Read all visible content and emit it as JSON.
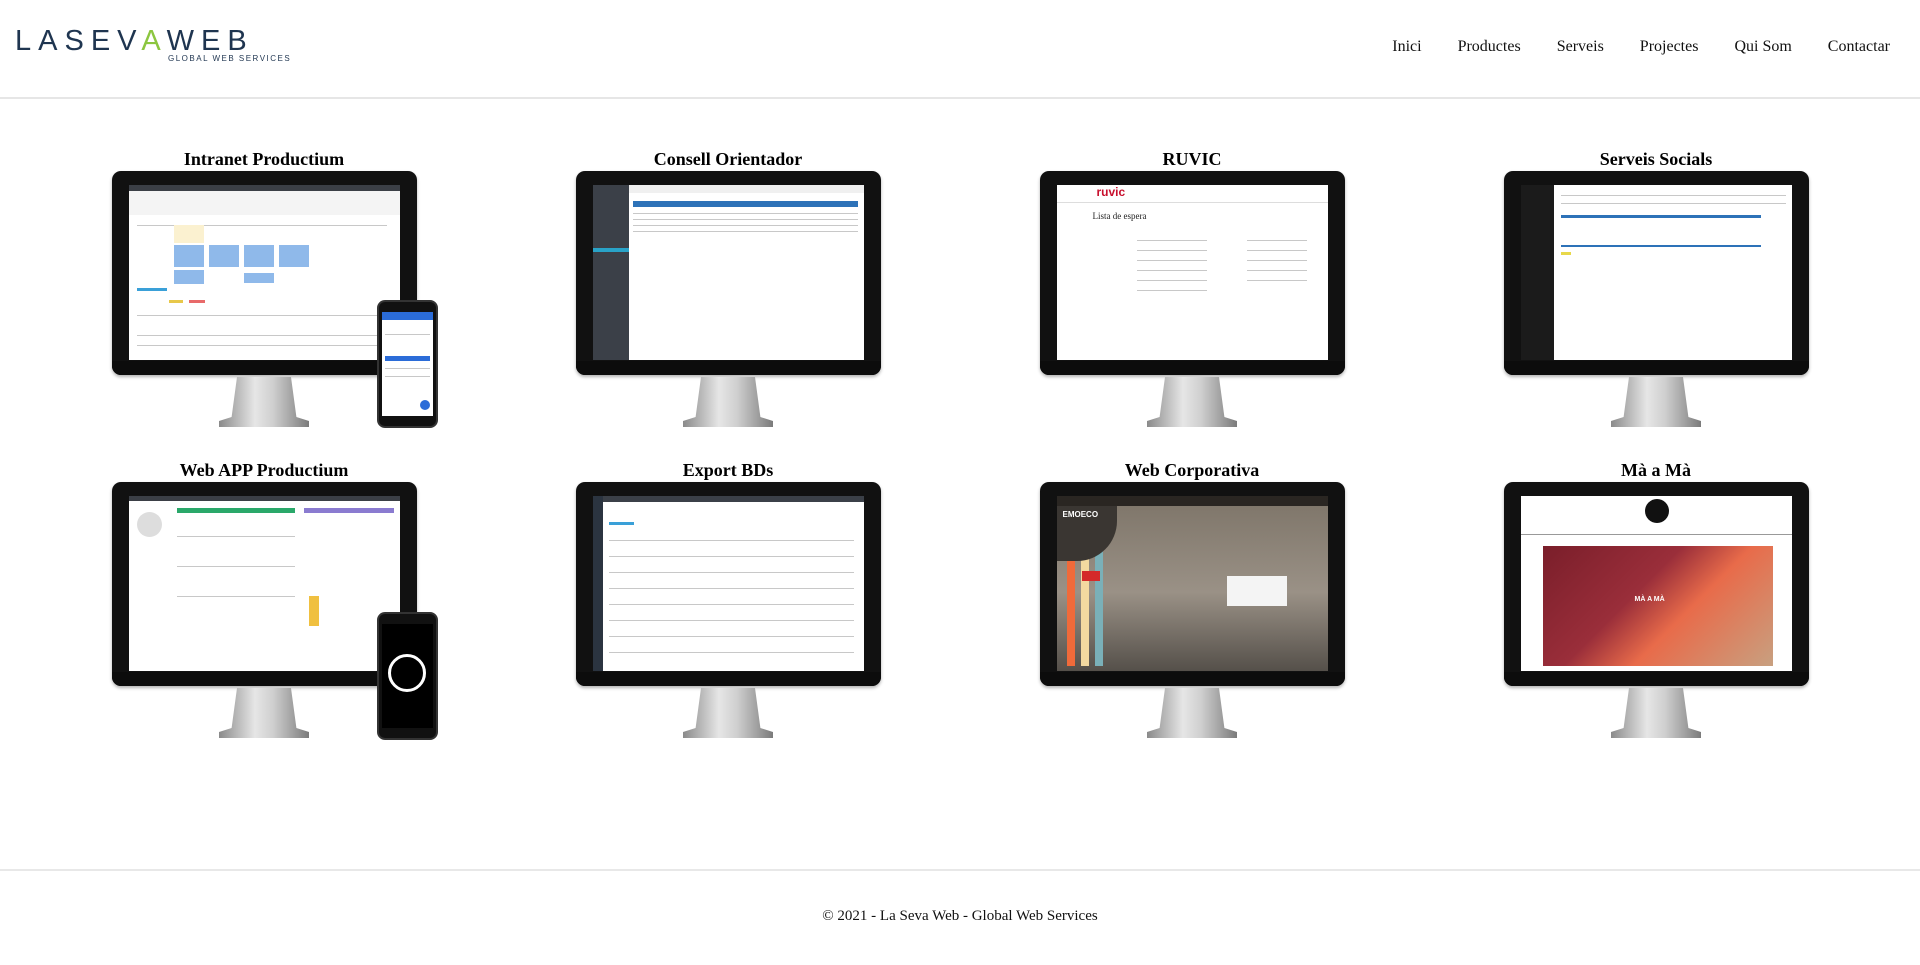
{
  "brand": {
    "name_part1": "LASEV",
    "name_v": "A",
    "name_part2": "WEB",
    "tagline": "GLOBAL WEB SERVICES"
  },
  "nav": {
    "items": [
      "Inici",
      "Productes",
      "Serveis",
      "Projectes",
      "Qui Som",
      "Contactar"
    ]
  },
  "projects": [
    {
      "title": "Intranet Productium"
    },
    {
      "title": "Consell Orientador"
    },
    {
      "title": "RUVIC"
    },
    {
      "title": "Serveis Socials"
    },
    {
      "title": "Web APP Productium"
    },
    {
      "title": "Export BDs"
    },
    {
      "title": "Web Corporativa"
    },
    {
      "title": "Mà a Mà"
    }
  ],
  "screens": {
    "ruvic_logo": "ruvic",
    "ruvic_heading": "Lista de espera",
    "emoeco_logo": "EMOECO",
    "maama_banner": "MÀ A MÀ"
  },
  "colors": {
    "accent_green": "#8cc63f",
    "brand_navy": "#1f3550",
    "ruvic_red": "#c8102e",
    "calendar_blue": "#8fb9ea"
  },
  "footer": {
    "text": "© 2021 - La Seva Web - Global Web Services"
  }
}
